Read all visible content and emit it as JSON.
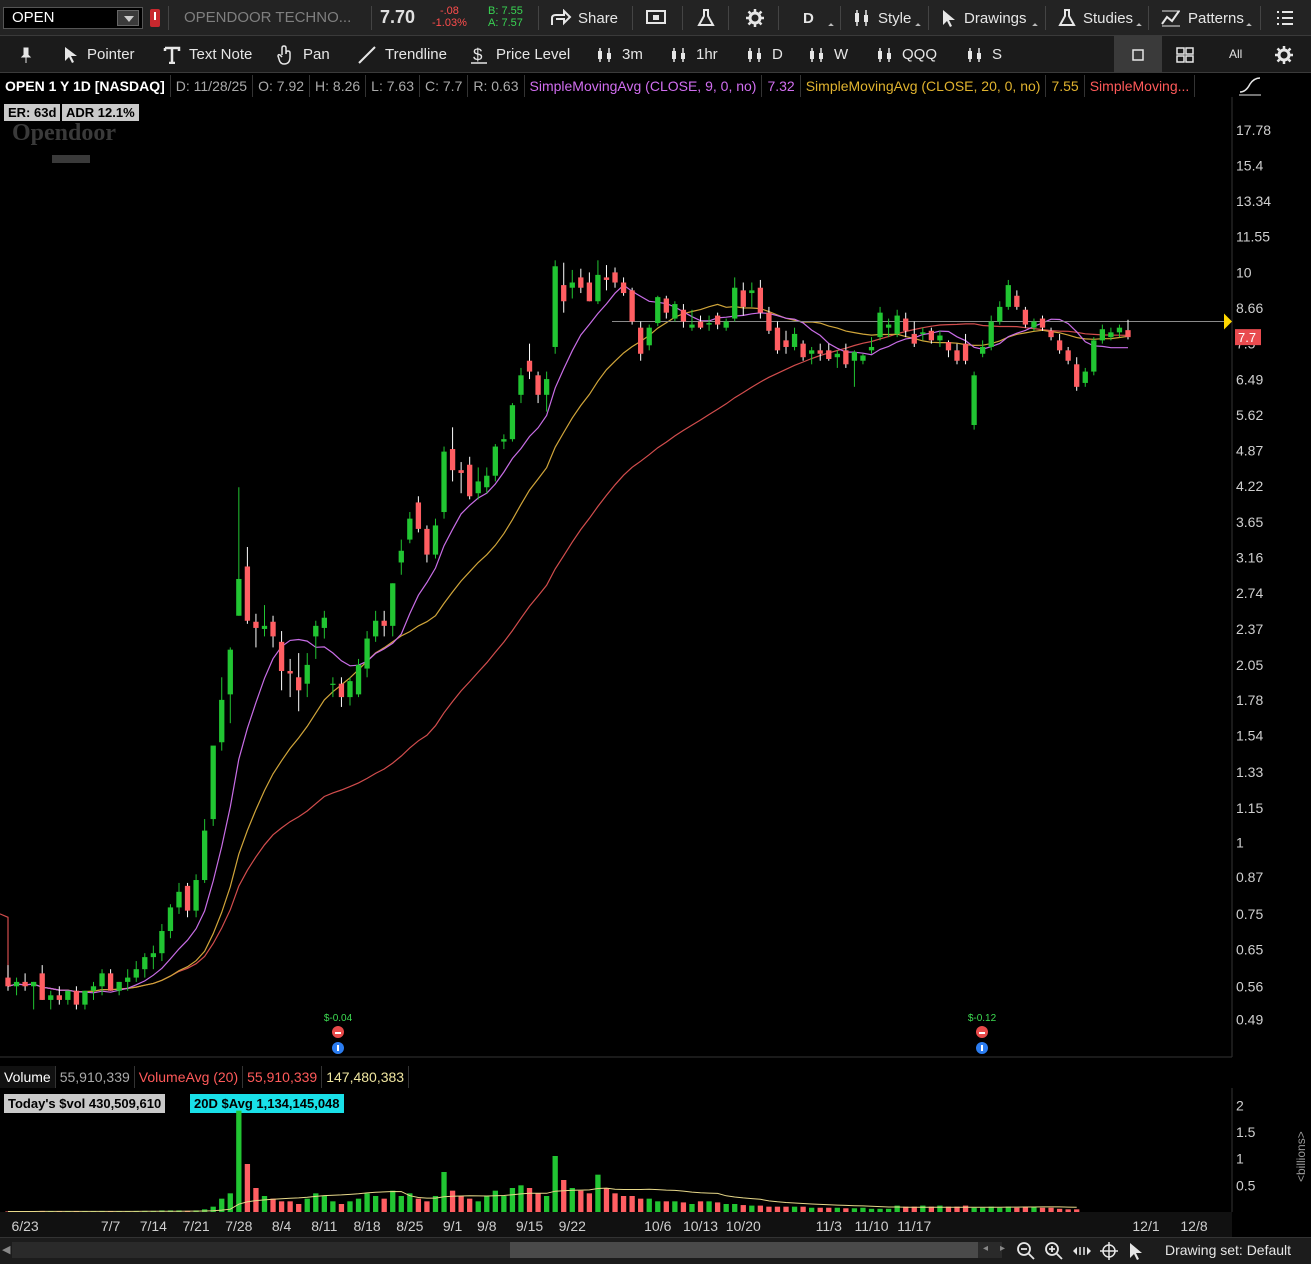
{
  "topbar": {
    "symbol": "OPEN",
    "company": "OPENDOOR TECHNO...",
    "last": "7.70",
    "net_change": "-.08",
    "pct_change": "-1.03%",
    "bid": "B: 7.55",
    "ask": "A: 7.57",
    "share_label": "Share",
    "aggregation": "D",
    "style_label": "Style",
    "drawings_label": "Drawings",
    "studies_label": "Studies",
    "patterns_label": "Patterns"
  },
  "toolbar2": {
    "pointer_label": "Pointer",
    "textnote_label": "Text Note",
    "pan_label": "Pan",
    "trendline_label": "Trendline",
    "pricelevel_label": "Price Level",
    "tf_3m": "3m",
    "tf_1hr": "1hr",
    "tf_d": "D",
    "tf_w": "W",
    "tf_qqq": "QQQ",
    "tf_s": "S",
    "all_label": "All"
  },
  "header": {
    "title": "OPEN 1 Y 1D [NASDAQ]",
    "date": "D: 11/28/25",
    "open": "O: 7.92",
    "high": "H: 8.26",
    "low": "L: 7.63",
    "close": "C: 7.7",
    "range": "R: 0.63",
    "sma9_label": "SimpleMovingAvg (CLOSE, 9, 0, no)",
    "sma9_value": "7.32",
    "sma20_label": "SimpleMovingAvg (CLOSE, 20, 0, no)",
    "sma20_value": "7.55",
    "sma50_label": "SimpleMoving..."
  },
  "badges": {
    "er": "ER: 63d",
    "adr": "ADR 12.1%",
    "watermark": "Opendoor"
  },
  "price_axis": {
    "ticks": [
      "17.78",
      "15.4",
      "13.34",
      "11.55",
      "10",
      "8.66",
      "7.5",
      "6.49",
      "5.62",
      "4.87",
      "4.22",
      "3.65",
      "3.16",
      "2.74",
      "2.37",
      "2.05",
      "1.78",
      "1.54",
      "1.33",
      "1.15",
      "1",
      "0.87",
      "0.75",
      "0.65",
      "0.56",
      "0.49"
    ],
    "current_price_tag": "7.7"
  },
  "date_axis": [
    "6/23",
    "7/7",
    "7/14",
    "7/21",
    "7/28",
    "8/4",
    "8/11",
    "8/18",
    "8/25",
    "9/1",
    "9/8",
    "9/15",
    "9/22",
    "10/6",
    "10/13",
    "10/20",
    "11/3",
    "11/10",
    "11/17",
    "12/1",
    "12/8"
  ],
  "earnings": [
    {
      "label": "$-0.04"
    },
    {
      "label": "$-0.12"
    }
  ],
  "volume_header": {
    "title": "Volume",
    "value": "55,910,339",
    "avg_label": "VolumeAvg (20)",
    "avg_value": "55,910,339",
    "avg_value2": "147,480,383",
    "todays_dollar_vol": "Today's $vol 430,509,610",
    "avg_20d": "20D $Avg 1,134,145,048"
  },
  "volume_axis": {
    "ticks": [
      "2",
      "1.5",
      "1",
      "0.5"
    ],
    "unit": "<billions>"
  },
  "statusbar": {
    "drawing_set": "Drawing set: Default"
  },
  "colors": {
    "up": "#21c532",
    "down": "#ff5e62",
    "sma9": "#c86de6",
    "sma20": "#d0a53a",
    "sma50": "#d24d4d",
    "price_tag": "#e94b4f",
    "arrow": "#ffd700"
  },
  "chart_data": {
    "type": "candlestick",
    "scale": "log",
    "ylim": [
      0.46,
      19.5
    ],
    "candles": [
      {
        "o": 0.58,
        "h": 0.61,
        "l": 0.55,
        "c": 0.56
      },
      {
        "o": 0.56,
        "h": 0.58,
        "l": 0.54,
        "c": 0.57
      },
      {
        "o": 0.57,
        "h": 0.59,
        "l": 0.55,
        "c": 0.56
      },
      {
        "o": 0.56,
        "h": 0.57,
        "l": 0.51,
        "c": 0.57
      },
      {
        "o": 0.59,
        "h": 0.61,
        "l": 0.53,
        "c": 0.53
      },
      {
        "o": 0.53,
        "h": 0.55,
        "l": 0.51,
        "c": 0.54
      },
      {
        "o": 0.54,
        "h": 0.56,
        "l": 0.52,
        "c": 0.53
      },
      {
        "o": 0.53,
        "h": 0.55,
        "l": 0.52,
        "c": 0.55
      },
      {
        "o": 0.55,
        "h": 0.56,
        "l": 0.51,
        "c": 0.52
      },
      {
        "o": 0.52,
        "h": 0.55,
        "l": 0.51,
        "c": 0.55
      },
      {
        "o": 0.55,
        "h": 0.57,
        "l": 0.53,
        "c": 0.56
      },
      {
        "o": 0.56,
        "h": 0.6,
        "l": 0.54,
        "c": 0.59
      },
      {
        "o": 0.59,
        "h": 0.6,
        "l": 0.55,
        "c": 0.55
      },
      {
        "o": 0.55,
        "h": 0.57,
        "l": 0.54,
        "c": 0.57
      },
      {
        "o": 0.57,
        "h": 0.6,
        "l": 0.55,
        "c": 0.58
      },
      {
        "o": 0.58,
        "h": 0.62,
        "l": 0.57,
        "c": 0.6
      },
      {
        "o": 0.6,
        "h": 0.64,
        "l": 0.58,
        "c": 0.63
      },
      {
        "o": 0.63,
        "h": 0.66,
        "l": 0.6,
        "c": 0.64
      },
      {
        "o": 0.64,
        "h": 0.72,
        "l": 0.62,
        "c": 0.7
      },
      {
        "o": 0.7,
        "h": 0.78,
        "l": 0.68,
        "c": 0.77
      },
      {
        "o": 0.77,
        "h": 0.85,
        "l": 0.75,
        "c": 0.82
      },
      {
        "o": 0.84,
        "h": 0.85,
        "l": 0.74,
        "c": 0.76
      },
      {
        "o": 0.76,
        "h": 0.88,
        "l": 0.74,
        "c": 0.86
      },
      {
        "o": 0.86,
        "h": 1.1,
        "l": 0.85,
        "c": 1.05
      },
      {
        "o": 1.1,
        "h": 1.3,
        "l": 1.07,
        "c": 1.48
      },
      {
        "o": 1.5,
        "h": 1.95,
        "l": 1.45,
        "c": 1.78
      },
      {
        "o": 1.82,
        "h": 2.2,
        "l": 1.62,
        "c": 2.18
      },
      {
        "o": 2.5,
        "h": 4.2,
        "l": 2.5,
        "c": 2.9
      },
      {
        "o": 3.05,
        "h": 3.3,
        "l": 2.42,
        "c": 2.45
      },
      {
        "o": 2.44,
        "h": 2.52,
        "l": 2.2,
        "c": 2.38
      },
      {
        "o": 2.37,
        "h": 2.61,
        "l": 2.3,
        "c": 2.4
      },
      {
        "o": 2.44,
        "h": 2.5,
        "l": 2.2,
        "c": 2.3
      },
      {
        "o": 2.25,
        "h": 2.35,
        "l": 1.85,
        "c": 2.0
      },
      {
        "o": 2.0,
        "h": 2.1,
        "l": 1.8,
        "c": 1.98
      },
      {
        "o": 1.95,
        "h": 2.15,
        "l": 1.7,
        "c": 1.85
      },
      {
        "o": 1.9,
        "h": 2.15,
        "l": 1.8,
        "c": 2.05
      },
      {
        "o": 2.3,
        "h": 2.45,
        "l": 2.1,
        "c": 2.4
      },
      {
        "o": 2.38,
        "h": 2.55,
        "l": 2.28,
        "c": 2.48
      },
      {
        "o": 1.9,
        "h": 1.95,
        "l": 1.8,
        "c": 1.9
      },
      {
        "o": 1.9,
        "h": 1.95,
        "l": 1.73,
        "c": 1.8
      },
      {
        "o": 1.8,
        "h": 1.95,
        "l": 1.74,
        "c": 1.92
      },
      {
        "o": 1.82,
        "h": 2.1,
        "l": 1.8,
        "c": 2.05
      },
      {
        "o": 2.02,
        "h": 2.35,
        "l": 1.95,
        "c": 2.28
      },
      {
        "o": 2.3,
        "h": 2.55,
        "l": 2.25,
        "c": 2.45
      },
      {
        "o": 2.45,
        "h": 2.55,
        "l": 2.3,
        "c": 2.4
      },
      {
        "o": 2.4,
        "h": 2.85,
        "l": 2.3,
        "c": 2.85
      },
      {
        "o": 3.1,
        "h": 3.4,
        "l": 2.95,
        "c": 3.25
      },
      {
        "o": 3.4,
        "h": 3.8,
        "l": 3.35,
        "c": 3.7
      },
      {
        "o": 3.95,
        "h": 4.05,
        "l": 3.5,
        "c": 3.55
      },
      {
        "o": 3.55,
        "h": 3.6,
        "l": 3.1,
        "c": 3.2
      },
      {
        "o": 3.2,
        "h": 3.7,
        "l": 3.15,
        "c": 3.6
      },
      {
        "o": 3.8,
        "h": 4.95,
        "l": 3.7,
        "c": 4.85
      },
      {
        "o": 4.9,
        "h": 5.35,
        "l": 4.3,
        "c": 4.5
      },
      {
        "o": 4.5,
        "h": 4.65,
        "l": 4.1,
        "c": 4.45
      },
      {
        "o": 4.6,
        "h": 4.75,
        "l": 4.0,
        "c": 4.05
      },
      {
        "o": 4.1,
        "h": 4.55,
        "l": 4.0,
        "c": 4.3
      },
      {
        "o": 4.2,
        "h": 4.55,
        "l": 4.1,
        "c": 4.4
      },
      {
        "o": 4.4,
        "h": 5.0,
        "l": 4.3,
        "c": 4.95
      },
      {
        "o": 5.05,
        "h": 5.2,
        "l": 4.9,
        "c": 5.1
      },
      {
        "o": 5.1,
        "h": 5.9,
        "l": 5.05,
        "c": 5.85
      },
      {
        "o": 6.1,
        "h": 6.8,
        "l": 5.9,
        "c": 6.6
      },
      {
        "o": 7.0,
        "h": 7.5,
        "l": 6.5,
        "c": 6.7
      },
      {
        "o": 6.6,
        "h": 6.7,
        "l": 5.9,
        "c": 6.1
      },
      {
        "o": 6.1,
        "h": 6.7,
        "l": 5.7,
        "c": 6.5
      },
      {
        "o": 7.4,
        "h": 10.5,
        "l": 7.2,
        "c": 10.25
      },
      {
        "o": 9.5,
        "h": 10.4,
        "l": 8.5,
        "c": 8.9
      },
      {
        "o": 9.4,
        "h": 10.1,
        "l": 9.0,
        "c": 9.6
      },
      {
        "o": 9.8,
        "h": 10.15,
        "l": 9.2,
        "c": 9.4
      },
      {
        "o": 9.6,
        "h": 10.0,
        "l": 8.9,
        "c": 8.9
      },
      {
        "o": 8.9,
        "h": 10.5,
        "l": 8.8,
        "c": 9.9
      },
      {
        "o": 9.8,
        "h": 10.3,
        "l": 9.3,
        "c": 9.7
      },
      {
        "o": 10.0,
        "h": 10.2,
        "l": 9.4,
        "c": 9.6
      },
      {
        "o": 9.6,
        "h": 9.8,
        "l": 9.1,
        "c": 9.2
      },
      {
        "o": 9.3,
        "h": 9.4,
        "l": 8.1,
        "c": 8.2
      },
      {
        "o": 8.0,
        "h": 8.2,
        "l": 7.0,
        "c": 7.2
      },
      {
        "o": 7.45,
        "h": 8.1,
        "l": 7.3,
        "c": 8.0
      },
      {
        "o": 8.15,
        "h": 9.1,
        "l": 8.05,
        "c": 9.05
      },
      {
        "o": 9.0,
        "h": 9.1,
        "l": 8.3,
        "c": 8.5
      },
      {
        "o": 8.3,
        "h": 8.9,
        "l": 8.2,
        "c": 8.8
      },
      {
        "o": 8.6,
        "h": 8.8,
        "l": 8.0,
        "c": 8.2
      },
      {
        "o": 8.0,
        "h": 8.6,
        "l": 7.9,
        "c": 8.1
      },
      {
        "o": 8.2,
        "h": 8.4,
        "l": 7.95,
        "c": 8.0
      },
      {
        "o": 8.1,
        "h": 8.4,
        "l": 7.9,
        "c": 8.15
      },
      {
        "o": 8.4,
        "h": 8.5,
        "l": 7.95,
        "c": 8.1
      },
      {
        "o": 8.0,
        "h": 8.3,
        "l": 7.9,
        "c": 8.2
      },
      {
        "o": 8.3,
        "h": 9.8,
        "l": 8.2,
        "c": 9.4
      },
      {
        "o": 9.3,
        "h": 9.6,
        "l": 8.4,
        "c": 8.7
      },
      {
        "o": 9.2,
        "h": 9.6,
        "l": 8.7,
        "c": 9.3
      },
      {
        "o": 9.4,
        "h": 9.7,
        "l": 8.3,
        "c": 8.5
      },
      {
        "o": 8.5,
        "h": 8.7,
        "l": 7.8,
        "c": 7.9
      },
      {
        "o": 8.0,
        "h": 8.2,
        "l": 7.2,
        "c": 7.3
      },
      {
        "o": 7.6,
        "h": 7.9,
        "l": 7.2,
        "c": 7.4
      },
      {
        "o": 7.4,
        "h": 8.0,
        "l": 7.3,
        "c": 7.8
      },
      {
        "o": 7.5,
        "h": 7.6,
        "l": 7.0,
        "c": 7.1
      },
      {
        "o": 7.2,
        "h": 7.4,
        "l": 6.9,
        "c": 7.3
      },
      {
        "o": 7.3,
        "h": 7.5,
        "l": 7.0,
        "c": 7.2
      },
      {
        "o": 7.3,
        "h": 7.5,
        "l": 7.0,
        "c": 7.05
      },
      {
        "o": 7.1,
        "h": 7.3,
        "l": 6.8,
        "c": 7.2
      },
      {
        "o": 7.3,
        "h": 7.5,
        "l": 6.8,
        "c": 6.9
      },
      {
        "o": 7.0,
        "h": 7.3,
        "l": 6.3,
        "c": 7.25
      },
      {
        "o": 7.0,
        "h": 7.2,
        "l": 6.9,
        "c": 7.15
      },
      {
        "o": 7.3,
        "h": 7.7,
        "l": 7.2,
        "c": 7.4
      },
      {
        "o": 7.7,
        "h": 8.7,
        "l": 7.6,
        "c": 8.5
      },
      {
        "o": 8.0,
        "h": 8.3,
        "l": 7.7,
        "c": 8.1
      },
      {
        "o": 7.8,
        "h": 8.6,
        "l": 7.7,
        "c": 8.4
      },
      {
        "o": 8.3,
        "h": 8.5,
        "l": 7.7,
        "c": 7.9
      },
      {
        "o": 7.8,
        "h": 8.2,
        "l": 7.4,
        "c": 7.5
      },
      {
        "o": 7.8,
        "h": 8.0,
        "l": 7.6,
        "c": 7.85
      },
      {
        "o": 7.9,
        "h": 8.0,
        "l": 7.5,
        "c": 7.6
      },
      {
        "o": 7.6,
        "h": 7.9,
        "l": 7.4,
        "c": 7.75
      },
      {
        "o": 7.55,
        "h": 7.6,
        "l": 7.1,
        "c": 7.3
      },
      {
        "o": 7.3,
        "h": 7.5,
        "l": 6.9,
        "c": 7.0
      },
      {
        "o": 7.5,
        "h": 7.8,
        "l": 6.9,
        "c": 7.0
      },
      {
        "o": 5.4,
        "h": 6.7,
        "l": 5.3,
        "c": 6.6
      },
      {
        "o": 7.2,
        "h": 7.6,
        "l": 7.1,
        "c": 7.4
      },
      {
        "o": 7.4,
        "h": 8.4,
        "l": 7.3,
        "c": 8.2
      },
      {
        "o": 8.2,
        "h": 8.9,
        "l": 8.1,
        "c": 8.7
      },
      {
        "o": 8.7,
        "h": 9.7,
        "l": 8.6,
        "c": 9.5
      },
      {
        "o": 9.1,
        "h": 9.3,
        "l": 8.6,
        "c": 8.7
      },
      {
        "o": 8.6,
        "h": 8.7,
        "l": 8.0,
        "c": 8.1
      },
      {
        "o": 8.0,
        "h": 8.3,
        "l": 7.9,
        "c": 8.2
      },
      {
        "o": 8.3,
        "h": 8.4,
        "l": 7.9,
        "c": 8.0
      },
      {
        "o": 7.9,
        "h": 8.0,
        "l": 7.6,
        "c": 7.7
      },
      {
        "o": 7.6,
        "h": 7.8,
        "l": 7.2,
        "c": 7.3
      },
      {
        "o": 7.3,
        "h": 7.4,
        "l": 6.9,
        "c": 7.0
      },
      {
        "o": 6.9,
        "h": 7.1,
        "l": 6.2,
        "c": 6.3
      },
      {
        "o": 6.4,
        "h": 6.8,
        "l": 6.3,
        "c": 6.7
      },
      {
        "o": 6.7,
        "h": 7.7,
        "l": 6.6,
        "c": 7.6
      },
      {
        "o": 7.6,
        "h": 8.1,
        "l": 7.5,
        "c": 7.95
      },
      {
        "o": 7.7,
        "h": 8.0,
        "l": 7.6,
        "c": 7.85
      },
      {
        "o": 7.85,
        "h": 8.1,
        "l": 7.7,
        "c": 8.0
      },
      {
        "o": 7.92,
        "h": 8.26,
        "l": 7.63,
        "c": 7.7
      }
    ],
    "volume_billions": [
      0.01,
      0.01,
      0.01,
      0.01,
      0.02,
      0.01,
      0.01,
      0.01,
      0.01,
      0.01,
      0.01,
      0.02,
      0.01,
      0.01,
      0.01,
      0.02,
      0.02,
      0.02,
      0.03,
      0.03,
      0.03,
      0.02,
      0.03,
      0.05,
      0.1,
      0.25,
      0.35,
      1.9,
      0.9,
      0.45,
      0.3,
      0.25,
      0.2,
      0.2,
      0.15,
      0.25,
      0.35,
      0.3,
      0.2,
      0.15,
      0.2,
      0.25,
      0.35,
      0.3,
      0.25,
      0.4,
      0.3,
      0.35,
      0.25,
      0.2,
      0.3,
      0.75,
      0.4,
      0.3,
      0.25,
      0.2,
      0.3,
      0.4,
      0.3,
      0.45,
      0.5,
      0.45,
      0.35,
      0.3,
      1.05,
      0.6,
      0.45,
      0.4,
      0.35,
      0.7,
      0.45,
      0.35,
      0.3,
      0.3,
      0.25,
      0.25,
      0.2,
      0.2,
      0.2,
      0.18,
      0.15,
      0.2,
      0.2,
      0.18,
      0.15,
      0.15,
      0.13,
      0.12,
      0.12,
      0.1,
      0.1,
      0.1,
      0.1,
      0.1,
      0.08,
      0.08,
      0.08,
      0.08,
      0.07,
      0.07,
      0.08,
      0.06,
      0.06,
      0.06,
      0.12,
      0.1,
      0.1,
      0.12,
      0.1,
      0.12,
      0.1,
      0.1,
      0.12,
      0.08,
      0.08,
      0.1,
      0.08,
      0.1,
      0.08,
      0.1,
      0.1,
      0.08,
      0.08,
      0.06,
      0.05,
      0.05
    ],
    "price_level_line": 8.2
  }
}
